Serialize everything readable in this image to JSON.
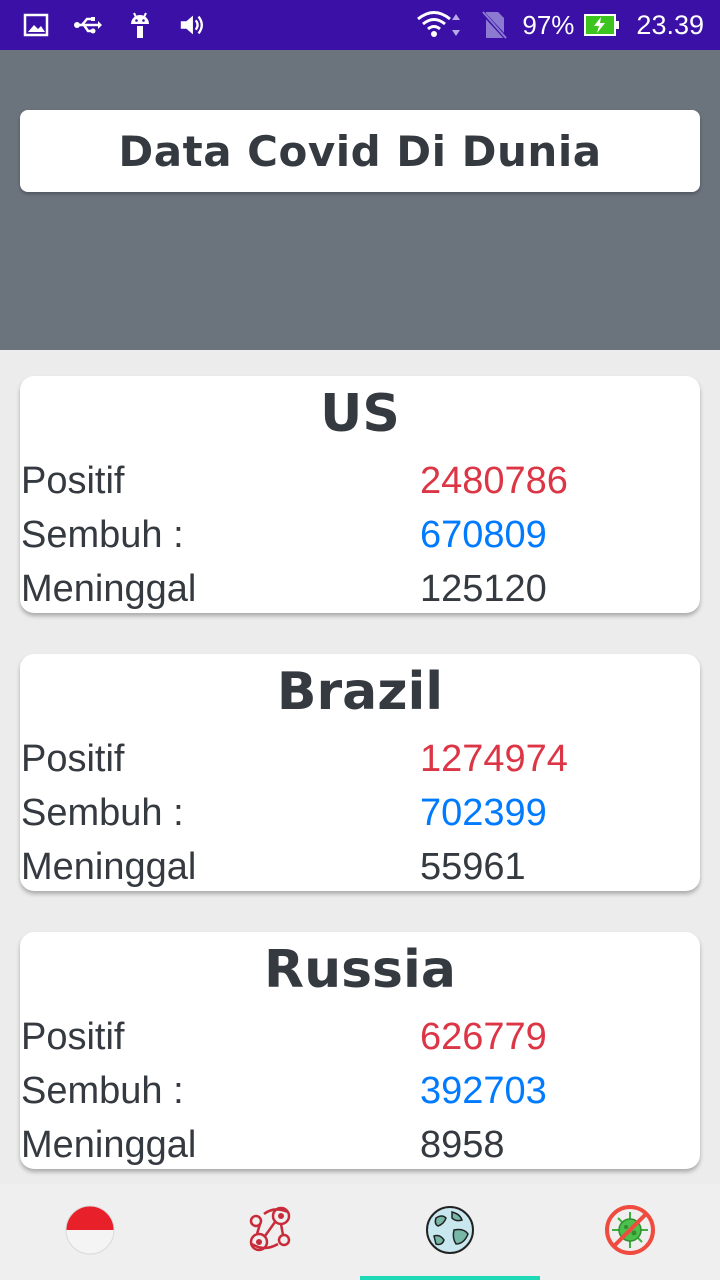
{
  "status_bar": {
    "icons_left": [
      "image-icon",
      "usb-icon",
      "android-icon",
      "volume-icon"
    ],
    "icons_right": [
      "wifi-icon",
      "no-sim-icon",
      "battery-charging-icon"
    ],
    "battery": "97%",
    "time": "23.39"
  },
  "header": {
    "title": "Data Covid Di Dunia"
  },
  "countries": [
    {
      "name": "US",
      "positif_label": "Positif",
      "positif": "2480786",
      "sembuh_label": "Sembuh :",
      "sembuh": "670809",
      "meninggal_label": "Meninggal",
      "meninggal": "125120"
    },
    {
      "name": "Brazil",
      "positif_label": "Positif",
      "positif": "1274974",
      "sembuh_label": "Sembuh :",
      "sembuh": "702399",
      "meninggal_label": "Meninggal",
      "meninggal": "55961"
    },
    {
      "name": "Russia",
      "positif_label": "Positif",
      "positif": "626779",
      "sembuh_label": "Sembuh :",
      "sembuh": "392703",
      "meninggal_label": "Meninggal",
      "meninggal": "8958"
    }
  ],
  "bottom_nav": {
    "items": [
      {
        "icon": "indonesia-flag-icon"
      },
      {
        "icon": "virus-network-icon"
      },
      {
        "icon": "globe-icon",
        "selected": true
      },
      {
        "icon": "no-virus-icon"
      }
    ],
    "accent": "#1ed9b6"
  },
  "colors": {
    "status_bar": "#3a10a6",
    "header": "#6b737d",
    "positif": "#dc3545",
    "sembuh": "#007bff",
    "text": "#343a40"
  }
}
